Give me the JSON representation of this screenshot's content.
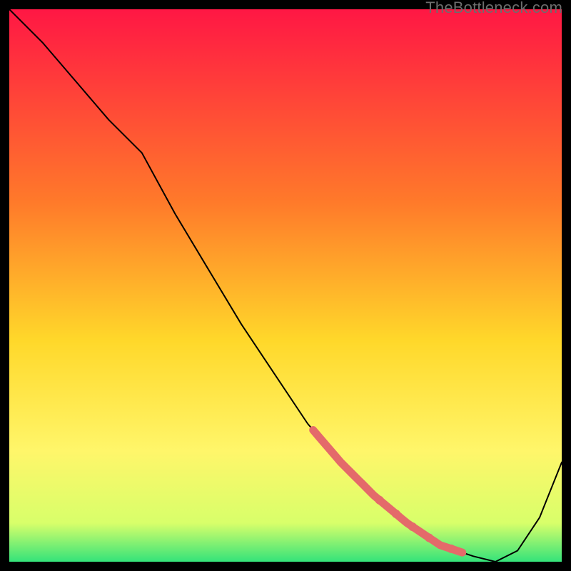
{
  "watermark": "TheBottleneck.com",
  "colors": {
    "curve": "#000000",
    "highlight": "#e46a6a",
    "dot": "#e46a6a"
  },
  "gradient": {
    "stops": [
      {
        "offset": "0%",
        "color": "#ff1744"
      },
      {
        "offset": "35%",
        "color": "#ff7a2a"
      },
      {
        "offset": "60%",
        "color": "#ffd82a"
      },
      {
        "offset": "80%",
        "color": "#fff66a"
      },
      {
        "offset": "93%",
        "color": "#d8ff6a"
      },
      {
        "offset": "100%",
        "color": "#34e37a"
      }
    ]
  },
  "chart_data": {
    "type": "line",
    "title": "",
    "xlabel": "",
    "ylabel": "",
    "xlim": [
      0,
      100
    ],
    "ylim": [
      0,
      100
    ],
    "x": [
      0,
      6,
      12,
      18,
      24,
      30,
      36,
      42,
      48,
      54,
      60,
      66,
      72,
      78,
      84,
      88,
      92,
      96,
      100
    ],
    "values": [
      100,
      94,
      87,
      80,
      74,
      63,
      53,
      43,
      34,
      25,
      18,
      12,
      7,
      3,
      1,
      0,
      2,
      8,
      18
    ],
    "highlight_range": [
      55,
      82
    ],
    "dot_x": [
      67,
      70,
      73,
      76,
      80
    ]
  }
}
